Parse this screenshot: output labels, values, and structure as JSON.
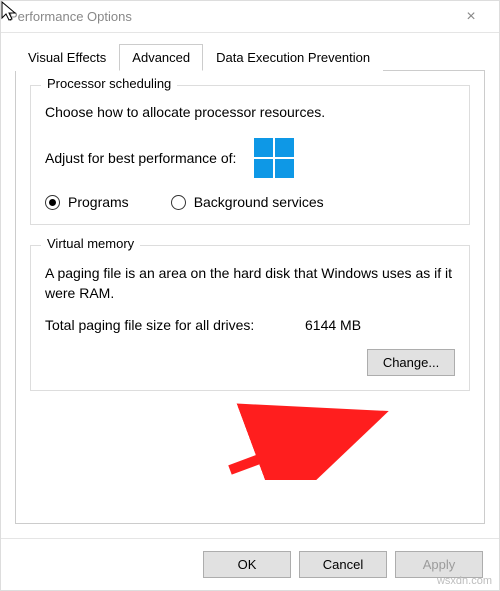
{
  "window": {
    "title": "Performance Options"
  },
  "tabs": {
    "visual": "Visual Effects",
    "advanced": "Advanced",
    "dep": "Data Execution Prevention"
  },
  "processor": {
    "legend": "Processor scheduling",
    "desc": "Choose how to allocate processor resources.",
    "adjust_label": "Adjust for best performance of:",
    "radio_programs": "Programs",
    "radio_background": "Background services"
  },
  "vm": {
    "legend": "Virtual memory",
    "desc": "A paging file is an area on the hard disk that Windows uses as if it were RAM.",
    "total_label": "Total paging file size for all drives:",
    "total_value": "6144 MB",
    "change_btn": "Change..."
  },
  "footer": {
    "ok": "OK",
    "cancel": "Cancel",
    "apply": "Apply"
  },
  "watermark": "wsxdn.com"
}
